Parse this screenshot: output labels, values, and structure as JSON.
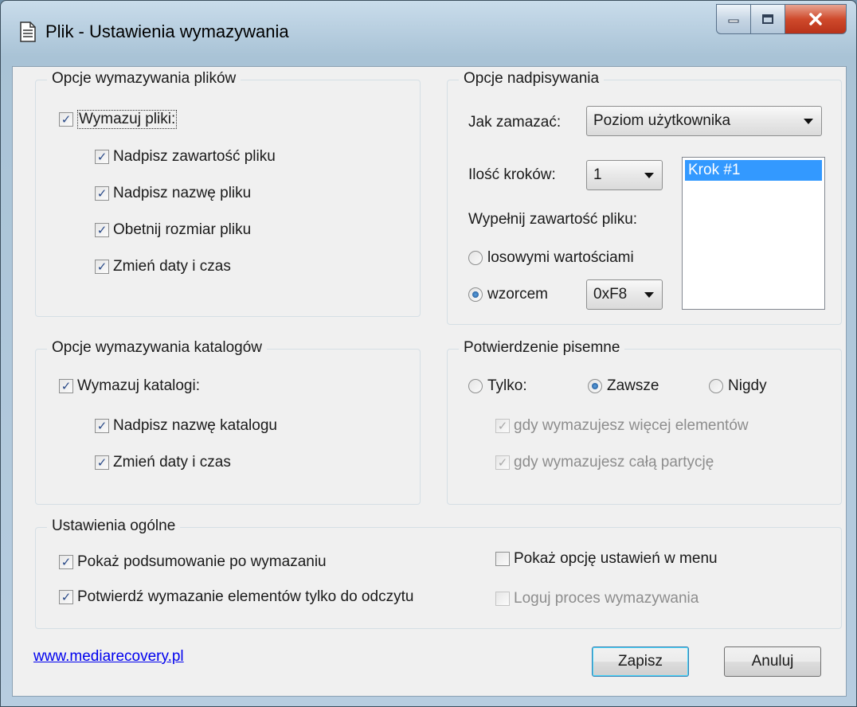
{
  "window": {
    "title": "Plik - Ustawienia wymazywania",
    "icon": "document-icon",
    "controls": [
      "minimize-icon",
      "maximize-icon",
      "close-icon"
    ]
  },
  "files_group": {
    "title": "Opcje wymazywania plików",
    "erase_files": {
      "label": "Wymazuj pliki:",
      "checked": true
    },
    "options": [
      {
        "label": "Nadpisz zawartość pliku",
        "checked": true
      },
      {
        "label": "Nadpisz nazwę pliku",
        "checked": true
      },
      {
        "label": "Obetnij rozmiar pliku",
        "checked": true
      },
      {
        "label": "Zmień daty i czas",
        "checked": true
      }
    ]
  },
  "overwrite_group": {
    "title": "Opcje nadpisywania",
    "method_label": "Jak zamazać:",
    "method_value": "Poziom użytkownika",
    "steps_label": "Ilość kroków:",
    "steps_value": "1",
    "steps_list": [
      "Krok #1"
    ],
    "fill_label": "Wypełnij zawartość pliku:",
    "fill_random": {
      "label": "losowymi wartościami",
      "selected": false
    },
    "fill_pattern": {
      "label": "wzorcem",
      "selected": true
    },
    "pattern_value": "0xF8"
  },
  "dirs_group": {
    "title": "Opcje wymazywania katalogów",
    "erase_dirs": {
      "label": "Wymazuj katalogi:",
      "checked": true
    },
    "options": [
      {
        "label": "Nadpisz nazwę katalogu",
        "checked": true
      },
      {
        "label": "Zmień daty i czas",
        "checked": true
      }
    ]
  },
  "confirm_group": {
    "title": "Potwierdzenie pisemne",
    "radios": [
      {
        "label": "Tylko:",
        "selected": false
      },
      {
        "label": "Zawsze",
        "selected": true
      },
      {
        "label": "Nigdy",
        "selected": false
      }
    ],
    "options": [
      {
        "label": "gdy wymazujesz więcej elementów",
        "checked": true,
        "disabled": true
      },
      {
        "label": "gdy wymazujesz całą partycję",
        "checked": true,
        "disabled": true
      }
    ]
  },
  "general_group": {
    "title": "Ustawienia ogólne",
    "options": [
      {
        "label": "Pokaż podsumowanie po wymazaniu",
        "checked": true,
        "disabled": false
      },
      {
        "label": "Pokaż opcję ustawień w menu",
        "checked": false,
        "disabled": false
      },
      {
        "label": "Potwierdź wymazanie elementów tylko do odczytu",
        "checked": true,
        "disabled": false
      },
      {
        "label": "Loguj proces wymazywania",
        "checked": false,
        "disabled": true
      }
    ]
  },
  "footer": {
    "link": "www.mediarecovery.pl",
    "save": "Zapisz",
    "cancel": "Anuluj"
  },
  "colors": {
    "accent": "#3399ff",
    "link": "#0000ee"
  }
}
